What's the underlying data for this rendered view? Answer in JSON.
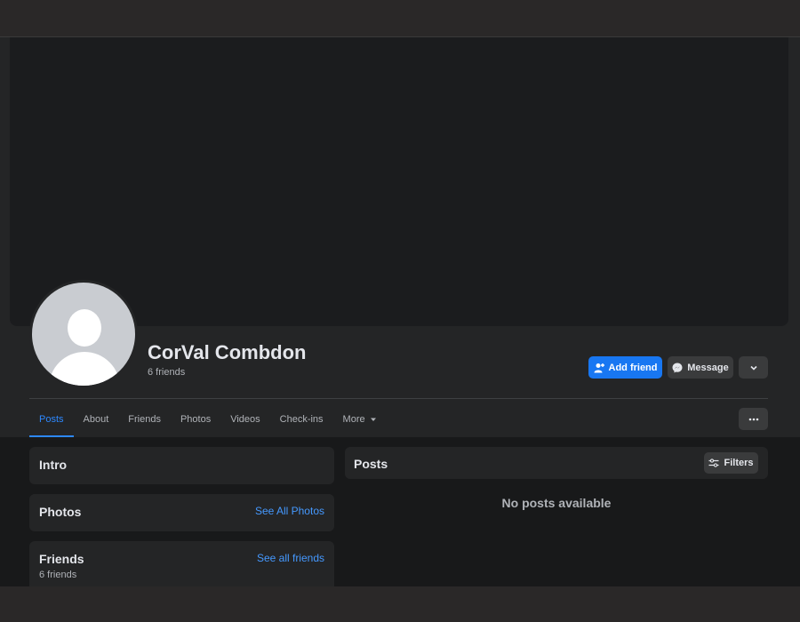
{
  "profile": {
    "name": "CorVal Combdon",
    "friends_count": "6 friends"
  },
  "actions": {
    "add_friend": "Add friend",
    "message": "Message"
  },
  "tabs": [
    {
      "label": "Posts"
    },
    {
      "label": "About"
    },
    {
      "label": "Friends"
    },
    {
      "label": "Photos"
    },
    {
      "label": "Videos"
    },
    {
      "label": "Check-ins"
    },
    {
      "label": "More"
    }
  ],
  "intro": {
    "title": "Intro"
  },
  "photos": {
    "title": "Photos",
    "link": "See All Photos"
  },
  "friends": {
    "title": "Friends",
    "link": "See all friends",
    "count": "6 friends"
  },
  "posts": {
    "title": "Posts",
    "filters": "Filters",
    "empty": "No posts available"
  },
  "colors": {
    "accent": "#1877f2",
    "background": "#18191a",
    "card": "#242526"
  },
  "icons": [
    "add-person-icon",
    "messenger-icon",
    "chevron-down-icon",
    "caret-down-icon",
    "ellipsis-icon",
    "filter-sliders-icon"
  ]
}
